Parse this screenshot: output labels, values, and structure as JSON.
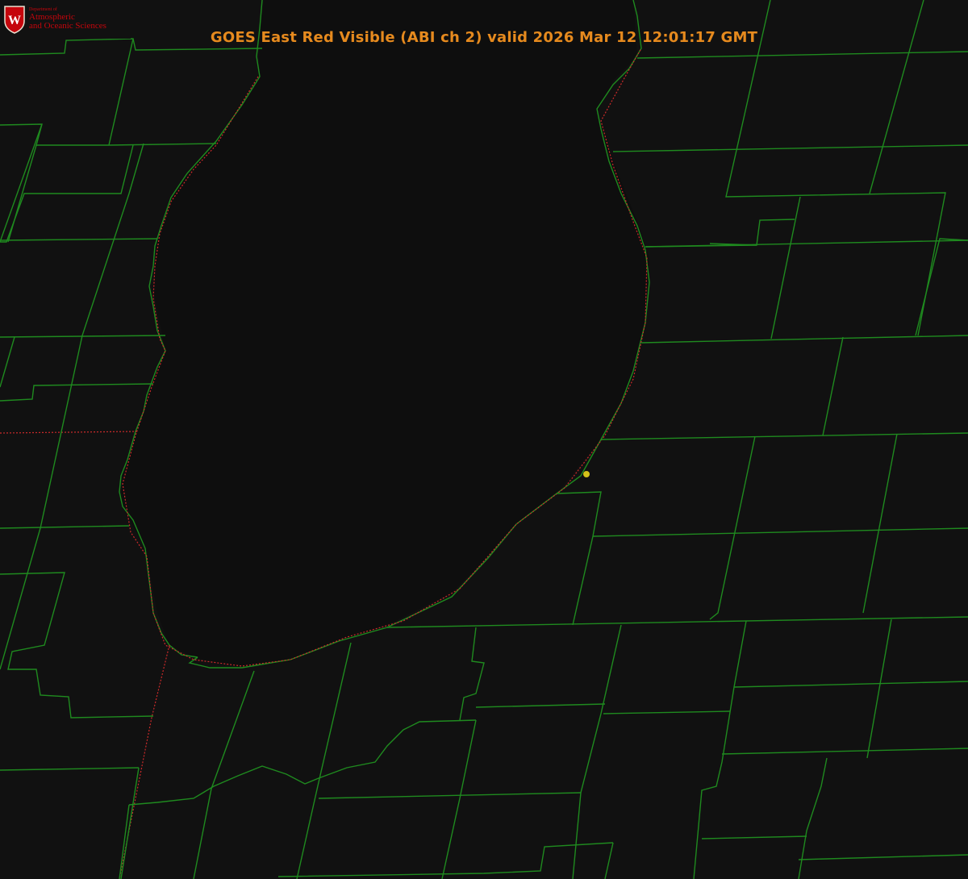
{
  "title": "GOES East Red Visible (ABI ch 2) valid 2026 Mar 12 12:01:17 GMT",
  "logo": {
    "dept": "Department of",
    "line1": "Atmospheric",
    "line2": "and Oceanic Sciences",
    "shield_letter": "W"
  },
  "colors": {
    "title": "#e68a1e",
    "county_lines": "#1f8a1f",
    "state_lines": "#cc2a2a",
    "marker": "#d4c21a",
    "logo": "#c5050c",
    "background": "#111111"
  },
  "icons": {
    "logo": "uw-crest-icon",
    "marker": "location-dot-icon"
  }
}
